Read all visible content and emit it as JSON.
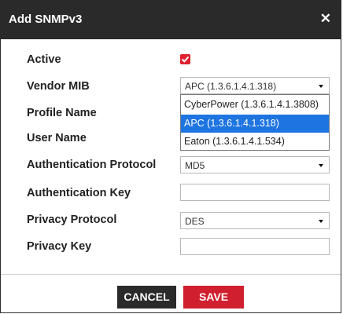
{
  "dialog": {
    "title": "Add SNMPv3",
    "close_glyph": "✕"
  },
  "fields": {
    "active": {
      "label": "Active",
      "checked": true
    },
    "vendor_mib": {
      "label": "Vendor MIB",
      "value": "APC (1.3.6.1.4.1.318)"
    },
    "profile_name": {
      "label": "Profile Name",
      "value": ""
    },
    "user_name": {
      "label": "User Name",
      "value": ""
    },
    "auth_protocol": {
      "label": "Authentication Protocol",
      "value": "MD5"
    },
    "auth_key": {
      "label": "Authentication Key",
      "value": ""
    },
    "privacy_protocol": {
      "label": "Privacy Protocol",
      "value": "DES"
    },
    "privacy_key": {
      "label": "Privacy Key",
      "value": ""
    }
  },
  "vendor_dropdown": {
    "options": [
      {
        "label": "CyberPower (1.3.6.1.4.1.3808)",
        "selected": false
      },
      {
        "label": "APC (1.3.6.1.4.1.318)",
        "selected": true
      },
      {
        "label": "Eaton (1.3.6.1.4.1.534)",
        "selected": false
      }
    ]
  },
  "buttons": {
    "cancel": "CANCEL",
    "save": "SAVE"
  },
  "colors": {
    "header": "#2a2a2a",
    "accent": "#d0202f",
    "selection": "#1e74e0"
  }
}
